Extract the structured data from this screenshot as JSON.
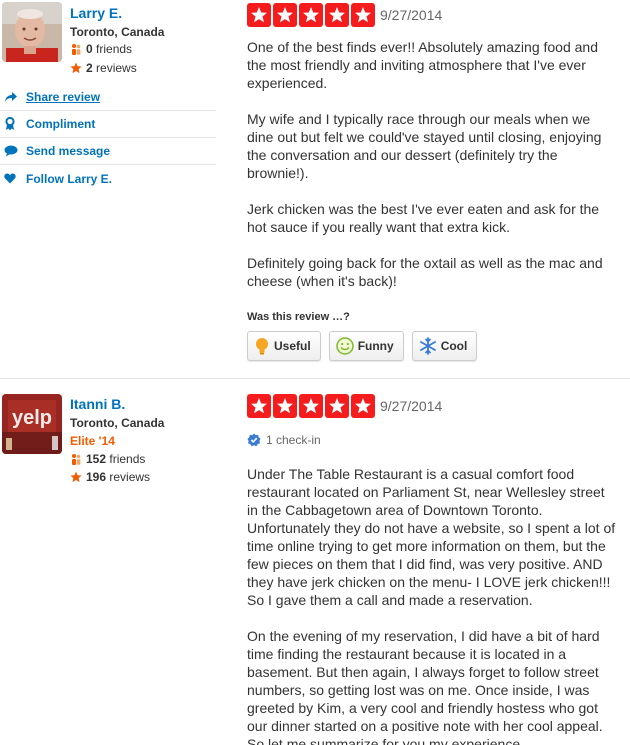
{
  "reviews": [
    {
      "user": {
        "name": "Larry E.",
        "location": "Toronto, Canada",
        "friends_count": "0",
        "friends_label": "friends",
        "reviews_count": "2",
        "reviews_label": "reviews"
      },
      "actions": {
        "share": "Share review",
        "compliment": "Compliment",
        "message": "Send message",
        "follow": "Follow Larry E."
      },
      "rating": 5,
      "date": "9/27/2014",
      "paragraphs": [
        "One of the best finds ever!!  Absolutely amazing food and the most friendly and inviting atmosphere that I've ever experienced.",
        "My wife and I typically race through our meals when we dine out but felt we could've stayed until closing, enjoying the conversation and our dessert (definitely try the brownie!).",
        "Jerk chicken was the best I've ever eaten and ask for the hot sauce if you really want that extra kick.",
        "Definitely going back for the oxtail as well as the mac and cheese (when it's back)!"
      ],
      "vote_prompt": "Was this review …?",
      "votes": {
        "useful": "Useful",
        "funny": "Funny",
        "cool": "Cool"
      }
    },
    {
      "user": {
        "name": "Itanni B.",
        "location": "Toronto, Canada",
        "elite": "Elite '14",
        "friends_count": "152",
        "friends_label": "friends",
        "reviews_count": "196",
        "reviews_label": "reviews"
      },
      "rating": 5,
      "date": "9/27/2014",
      "checkin": "1 check-in",
      "paragraphs": [
        "Under The Table Restaurant is a casual comfort food restaurant located on Parliament St, near Wellesley street in the Cabbagetown area of Downtown Toronto. Unfortunately they do not have a website, so I spent a lot of time online trying to get more information on them, but the few pieces on them that I did find, was very positive. AND they have jerk chicken on the menu- I LOVE jerk chicken!!! So I gave them a call and made a reservation.",
        "On the evening of my reservation, I did have a bit of hard time finding the restaurant because it is located in a basement. But then again, I always forget to follow street numbers, so getting lost was on me. Once inside, I was greeted by Kim, a very cool and friendly hostess who got our dinner started on a positive note with her cool appeal. So let me summarize for you my experience."
      ]
    }
  ],
  "colors": {
    "link": "#0073bb",
    "star": "#f41c1c",
    "elite": "#f15c00",
    "checkin": "#3a7bd5"
  },
  "icons": {
    "friends": "friends-icon",
    "reviews": "star-icon",
    "share": "share-arrow-icon",
    "compliment": "ribbon-icon",
    "message": "speech-bubble-icon",
    "follow": "heart-icon",
    "useful": "lightbulb-icon",
    "funny": "smiley-icon",
    "cool": "snowflake-icon",
    "checkin": "checkin-badge-icon"
  }
}
